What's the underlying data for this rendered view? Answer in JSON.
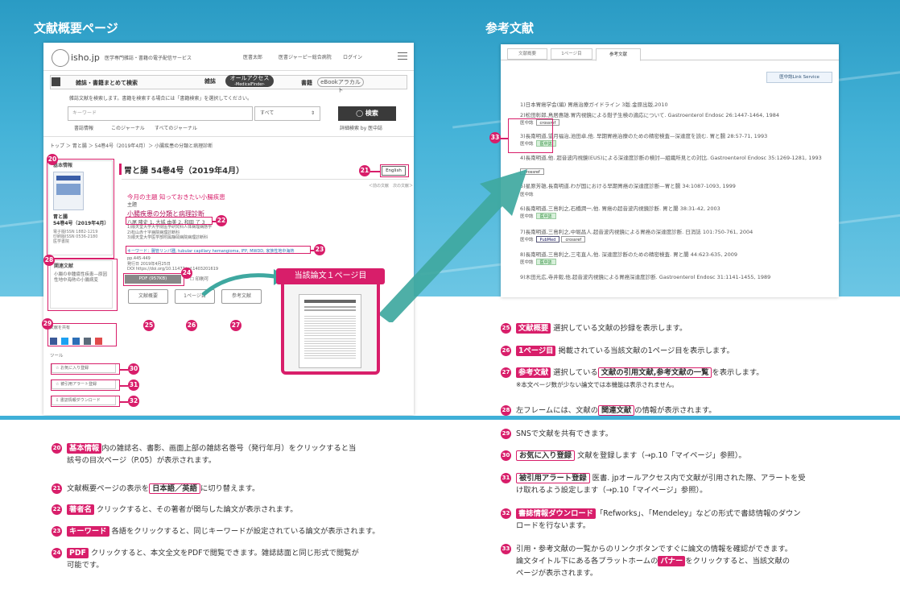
{
  "left_title": "文献概要ページ",
  "right_title": "参考文献",
  "site": {
    "logo": "isho.jp",
    "tagline": "医学専門雑誌・書籍の電子配信サービス",
    "nav": [
      "医書太郎",
      "医書ジャーピー総合病院",
      "ログイン"
    ],
    "tabs": {
      "search": "雑誌・書籍まとめて検索",
      "zasshi": "雑誌",
      "all_access": "オールアクセス",
      "medical_finder": "-MedicalFinder-",
      "shoseki": "書籍",
      "ebook": "eBookアラカルト"
    },
    "hint": "雑誌文献を検索します。書籍を検索する場合には「書籍検索」を選択してください。",
    "keyword_placeholder": "キーワード",
    "select_value": "すべて",
    "search_button": "検索",
    "scope": [
      "書誌情報",
      "このジャーナル",
      "すべてのジャーナル"
    ],
    "advanced": "詳細検索 by 医中誌",
    "breadcrumb": "トップ ＞ 胃と腸 ＞ 54巻4号（2019年4月）＞ 小腸疾患の分類と病理診断"
  },
  "article": {
    "sidebar_head": "基本情報",
    "journal": "胃と腸",
    "issue_short": "54巻4号（2019年4月）",
    "issn": [
      "電子版ISSN 1882-1219",
      "印刷版ISSN 0536-2180",
      "医学書院"
    ],
    "issue_title": "胃と腸 54巻4号（2019年4月）",
    "english_btn": "English",
    "prevnext": "＜前の文献　次の文献＞",
    "theme": "今月の主題 知っておきたい小腸疾患",
    "category": "主題",
    "title": "小腸疾患の分類と病理診断",
    "authors": "八尾 隆史 1, 大城 由美 2, 和田 了 3",
    "affiliations": [
      "1)順天堂大学大学院医学研究科人体病理病態学",
      "2)松山赤十字病院病理診断科",
      "3)順天堂大学医学部附属静岡病院病理診断科"
    ],
    "keywords": "キーワード：腸管リンパ腫, tubular capillary hemangioma, IFP, MWDD, 家族性地中海熱",
    "pp": "pp.445-449",
    "date": "発行日 2019年4月25日",
    "doi": "DOI https://doi.org/10.11477/mf.1403201619",
    "pdf_btn": "PDF (957KB)",
    "related_head": "関連文献",
    "related_text": "小腸の非腫瘍性疾患—原因性地中海熱の小腸病変",
    "share_head": "文献を共有",
    "tool_head": "ツール",
    "tools": [
      "お気に入り登録",
      "被引用アラート登録",
      "書誌情報ダウンロード"
    ],
    "buttons": [
      "文献概要",
      "1ページ目",
      "参考文献"
    ],
    "popup_label": "当該論文１ページ目"
  },
  "refs": {
    "tabs": [
      "文献概要",
      "1ページ目",
      "参考文献"
    ],
    "service": "医中誌Link Service",
    "items": [
      "1)日本胃癌学会(編) 胃癌治療ガイドライン 3版.金原出版,2010",
      "2)松田彰郎,鳥居惠雄.胃内視鏡による鉗子生検の適応について. Gastroenterol Endosc 26:1447-1464, 1984",
      "3)長南明道,望月福治,池田卓,他. 早期胃癌治療のための精密検査—深達度を読む. 胃と腸 28:57-71, 1993",
      "4)長南明道,他. 超音波内視鏡(EUS)による深達度診断の検討—組織所見との対比. Gastroenterol Endosc 35:1269-1281, 1993",
      "5)星原芳雄,長南明道.わが国における早期胃癌の深達度診断—胃と腸 34:1087-1093, 1999",
      "6)長南明道,三島利之,石橋潤一,他. 胃癌の超音波内視鏡診断. 胃と腸 38:31-42, 2003",
      "7)長南明道,三島利之,中堀昌人.超音波内視鏡による胃癌の深達度診断. 日消誌 101:750-761, 2004",
      "8)長南明道,三島利之,三宅直人,他. 深達度診断のための精密検査. 胃と腸 44:623-635, 2009",
      "9)木田光広,寺井毅,他.超音波内視鏡による胃癌深達度診断. Gastroenterol Endosc 31:1141-1455, 1989"
    ],
    "logo_labels": [
      "医中誌",
      "crossref",
      "PubMed"
    ]
  },
  "notes": [
    {
      "n": "20",
      "tag": "基本情報",
      "text": "内の雑誌名、書影、画面上部の雑誌名巻号（発行年月）をクリックすると当",
      "text2": "該号の目次ページ（P.05）が表示されます。"
    },
    {
      "n": "21",
      "pre": "文献概要ページの表示を",
      "otag": "日本語／英語",
      "text": "に切り替えます。"
    },
    {
      "n": "22",
      "tag": "著者名",
      "text": "クリックすると、その著者が関与した論文が表示されます。"
    },
    {
      "n": "23",
      "tag": "キーワード",
      "text": "各語をクリックすると、同じキーワードが設定されている論文が表示されます。"
    },
    {
      "n": "24",
      "tag": "PDF",
      "text": "クリックすると、本文全文をPDFで閲覧できます。雑誌誌面と同じ形式で閲覧が",
      "text2": "可能です。"
    },
    {
      "n": "25",
      "tag": "文献概要",
      "text": "選択している文献の抄録を表示します。"
    },
    {
      "n": "26",
      "tag": "1ページ目",
      "text": "掲載されている当該文献の1ページ目を表示します。"
    },
    {
      "n": "27",
      "tag": "参考文献",
      "pre2": "選択している",
      "otag": "文献の引用文献,参考文献の一覧",
      "text": "を表示します。",
      "small": "※本文ページ数が少ない論文では本機能は表示されません。"
    },
    {
      "n": "28",
      "pre": "左フレームには、文献の",
      "otag": "関連文献",
      "text": "の情報が表示されます。"
    },
    {
      "n": "29",
      "text": "SNSで文献を共有できます。"
    },
    {
      "n": "30",
      "otag": "お気に入り登録",
      "text": "文献を登録します（→p.10「マイページ」参照）。"
    },
    {
      "n": "31",
      "otag": "被引用アラート登録",
      "text": "医書. jpオールアクセス内で文献が引用された際、アラートを受",
      "text2": "け取れるよう設定します（→p.10「マイページ」参照）。"
    },
    {
      "n": "32",
      "tag": "書誌情報ダウンロード",
      "text": "「Refworks」、「Mendeley」などの形式で書誌情報のダウン",
      "text2": "ロードを行ないます。"
    },
    {
      "n": "33",
      "text": "引用・参考文献の一覧からのリンクボタンですぐに論文の情報を確認ができます。",
      "text2": "論文タイトル下にある各プラットホームの",
      "tag2": "バナー",
      "text3": "をクリックすると、当該文献の",
      "text4": "ページが表示されます。"
    }
  ]
}
